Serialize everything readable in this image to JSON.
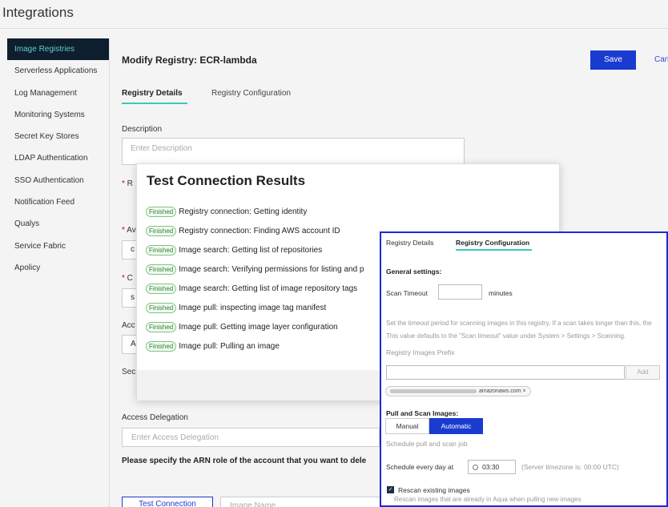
{
  "app": {
    "title": "Integrations"
  },
  "sidebar": {
    "items": [
      {
        "label": "Image Registries",
        "active": true
      },
      {
        "label": "Serverless Applications"
      },
      {
        "label": "Log Management"
      },
      {
        "label": "Monitoring Systems"
      },
      {
        "label": "Secret Key Stores"
      },
      {
        "label": "LDAP Authentication"
      },
      {
        "label": "SSO Authentication"
      },
      {
        "label": "Notification Feed"
      },
      {
        "label": "Qualys"
      },
      {
        "label": "Service Fabric"
      },
      {
        "label": "Apolicy"
      }
    ]
  },
  "page": {
    "title": "Modify Registry: ECR-lambda",
    "save_label": "Save",
    "cancel_label": "Can",
    "tabs": [
      {
        "label": "Registry Details"
      },
      {
        "label": "Registry Configuration"
      }
    ]
  },
  "form": {
    "description_label": "Description",
    "description_placeholder": "Enter Description",
    "field_r_prefix": "R",
    "field_a_prefix": "Aᴠ",
    "field_c_prefix": "C",
    "value_c": "c",
    "value_s": "s",
    "acc_label": "Acc",
    "value_a": "A",
    "sec_label": "Sec",
    "access_delegation_label": "Access Delegation",
    "access_delegation_placeholder": "Enter Access Delegation",
    "arn_note": "Please specify the ARN role of the account that you want to dele",
    "test_connection_label": "Test Connection",
    "image_name_placeholder": "Image Name"
  },
  "test_results": {
    "title": "Test Connection Results",
    "badge": "Finished",
    "rows": [
      "Registry connection: Getting identity",
      "Registry connection: Finding AWS account ID",
      "Image search: Getting list of repositories",
      "Image search: Verifying permissions for listing and p",
      "Image search: Getting list of image repository tags",
      "Image pull: inspecting image tag manifest",
      "Image pull: Getting image layer configuration",
      "Image pull: Pulling an image"
    ]
  },
  "config": {
    "tab_details": "Registry Details",
    "tab_config": "Registry Configuration",
    "general_settings": "General settings:",
    "scan_timeout_label": "Scan Timeout",
    "scan_timeout_unit": "minutes",
    "scan_help_1": "Set the timeout period for scanning images in this registry. If a scan takes longer than this, the",
    "scan_help_2": "This value defaults to the \"Scan timeout\" value under System > Settings > Scanning.",
    "prefix_label": "Registry Images Prefix",
    "add_label": "Add",
    "chip_suffix": "amazonaws.com",
    "chip_close": "×",
    "pull_scan_label": "Pull and Scan Images:",
    "mode_manual": "Manual",
    "mode_automatic": "Automatic",
    "schedule_help": "Schedule pull and scan job",
    "schedule_label": "Schedule every day at",
    "schedule_time": "03:30",
    "server_tz": "(Server timezone is: 00:00 UTC)",
    "rescan_label": "Rescan existing images",
    "rescan_checked": true,
    "rescan_help": "Rescan images that are already in Aqua when pulling new images"
  },
  "colors": {
    "accent": "#1a3bcf",
    "teal": "#3ac9bc",
    "sidebar_active_bg": "#0e1e2e",
    "highlight_border": "#1c2bd6"
  }
}
